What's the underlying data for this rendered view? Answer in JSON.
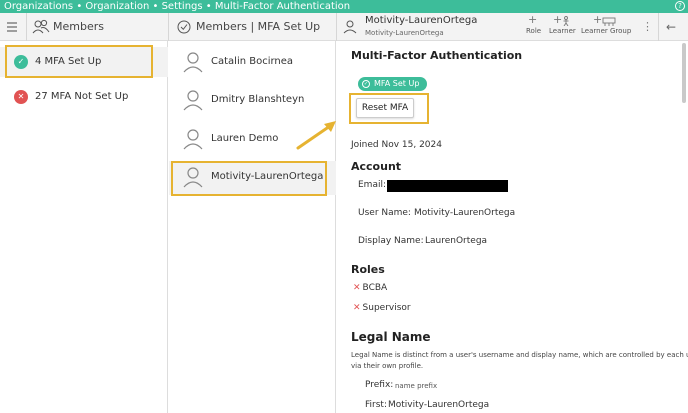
{
  "topbar": {
    "breadcrumb": "Organizations • Organization • Settings • Multi-Factor Authentication",
    "help_icon": "?"
  },
  "header": {
    "menu_icon": "hamburger-icon",
    "members_title": "Members",
    "mfa_title": "Members | MFA Set Up",
    "user_name": "Motivity-LaurenOrtega",
    "user_sub": "Motivity-LaurenOrtega",
    "actions": [
      {
        "icon": "+",
        "label": "Role"
      },
      {
        "icon": "+",
        "label": "Learner"
      },
      {
        "icon": "+",
        "label": "Learner Group"
      }
    ],
    "more_icon": "⋮",
    "back_icon": "←"
  },
  "members_list": [
    {
      "count_label": "4 MFA Set Up",
      "status": "ok",
      "color": "#3dbd9a"
    },
    {
      "count_label": "27 MFA Not Set Up",
      "status": "not",
      "color": "#e15353"
    }
  ],
  "mfa_members": [
    {
      "name": "Catalin Bocirnea"
    },
    {
      "name": "Dmitry Blanshteyn"
    },
    {
      "name": "Lauren Demo"
    },
    {
      "name": "Motivity-LaurenOrtega"
    }
  ],
  "detail": {
    "title": "Multi-Factor Authentication",
    "badge": "MFA Set Up",
    "reset_button": "Reset MFA",
    "joined": "Joined Nov 15, 2024",
    "account_heading": "Account",
    "email_label": "Email:",
    "username_label": "User Name:",
    "username_value": "Motivity-LaurenOrtega",
    "display_label": "Display Name:",
    "display_value": "LaurenOrtega",
    "roles_heading": "Roles",
    "roles": [
      "BCBA",
      "Supervisor"
    ],
    "legal_heading": "Legal Name",
    "legal_desc_1": "Legal Name is distinct from a user's username and display name, which are controlled by each user",
    "legal_desc_2": "via their own profile.",
    "prefix_label": "Prefix:",
    "prefix_placeholder": "name prefix",
    "first_label": "First:",
    "first_value": "Motivity-LaurenOrtega"
  },
  "colors": {
    "accent": "#3dbd9a",
    "highlight": "#e6b331",
    "danger": "#e15353"
  }
}
